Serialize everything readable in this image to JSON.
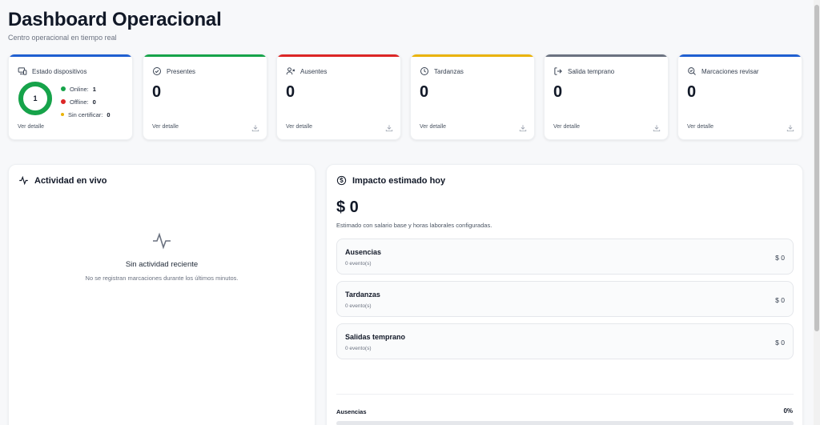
{
  "header": {
    "title": "Dashboard Operacional",
    "subtitle": "Centro operacional en tiempo real"
  },
  "kpis": {
    "dispositivos": {
      "label": "Estado dispositivos",
      "total": "1",
      "online_label": "Online:",
      "online_value": "1",
      "offline_label": "Offline:",
      "offline_value": "0",
      "sincert_label": "Sin certificar:",
      "sincert_value": "0",
      "link": "Ver detalle",
      "color": "#1f5fd1",
      "online_fraction": 1.0
    },
    "presentes": {
      "label": "Presentes",
      "value": "0",
      "link": "Ver detalle",
      "color": "#16a34a"
    },
    "ausentes": {
      "label": "Ausentes",
      "value": "0",
      "link": "Ver detalle",
      "color": "#dc2626"
    },
    "tardanzas": {
      "label": "Tardanzas",
      "value": "0",
      "link": "Ver detalle",
      "color": "#eab308"
    },
    "salida": {
      "label": "Salida temprano",
      "value": "0",
      "link": "Ver detalle",
      "color": "#6b7280"
    },
    "marcaciones": {
      "label": "Marcaciones revisar",
      "value": "0",
      "link": "Ver detalle",
      "color": "#1f5fd1"
    }
  },
  "actividad": {
    "title": "Actividad en vivo",
    "empty_title": "Sin actividad reciente",
    "empty_text": "No se registran marcaciones durante los últimos minutos."
  },
  "impacto": {
    "title": "Impacto estimado hoy",
    "total": "$ 0",
    "note": "Estimado con salario base y horas laborales configuradas.",
    "items": [
      {
        "name": "Ausencias",
        "count": "0 evento(s)",
        "amount": "$ 0"
      },
      {
        "name": "Tardanzas",
        "count": "0 evento(s)",
        "amount": "$ 0"
      },
      {
        "name": "Salidas temprano",
        "count": "0 evento(s)",
        "amount": "$ 0"
      }
    ],
    "footer_label": "Ausencias",
    "footer_pct": "0%",
    "footer_fraction": 0
  },
  "colors": {
    "online": "#16a34a",
    "offline": "#dc2626",
    "sincert": "#eab308"
  }
}
